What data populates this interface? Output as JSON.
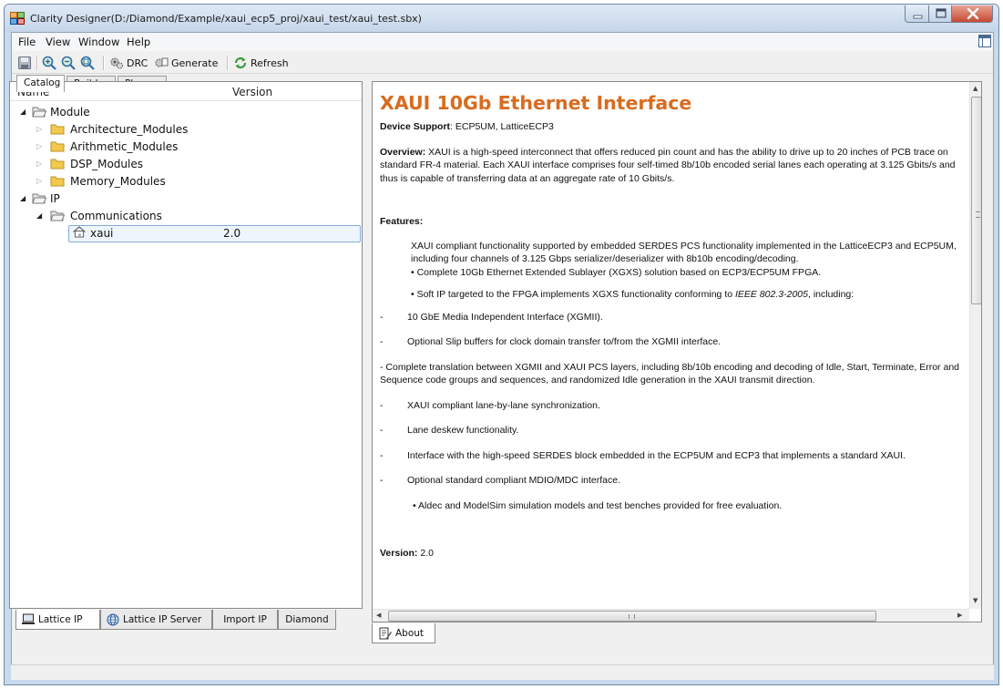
{
  "window": {
    "title": "Clarity Designer(D:/Diamond/Example/xaui_ecp5_proj/xaui_test/xaui_test.sbx)"
  },
  "menu": [
    "File",
    "View",
    "Window",
    "Help"
  ],
  "toolbar": {
    "drc_label": "DRC",
    "generate_label": "Generate",
    "refresh_label": "Refresh"
  },
  "main_tabs": [
    "Catalog",
    "Builder",
    "Planner"
  ],
  "catalog": {
    "columns": {
      "name": "Name",
      "version": "Version"
    },
    "tree": [
      {
        "label": "Module",
        "level": 0,
        "state": "expanded",
        "icon": "folder-open-icon"
      },
      {
        "label": "Architecture_Modules",
        "level": 1,
        "state": "collapsed",
        "icon": "folder-icon"
      },
      {
        "label": "Arithmetic_Modules",
        "level": 1,
        "state": "collapsed",
        "icon": "folder-icon"
      },
      {
        "label": "DSP_Modules",
        "level": 1,
        "state": "collapsed",
        "icon": "folder-icon"
      },
      {
        "label": "Memory_Modules",
        "level": 1,
        "state": "collapsed",
        "icon": "folder-icon"
      },
      {
        "label": "IP",
        "level": 0,
        "state": "expanded",
        "icon": "folder-open-icon"
      },
      {
        "label": "Communications",
        "level": 1,
        "state": "expanded",
        "icon": "folder-open-icon"
      },
      {
        "label": "xaui",
        "level": 2,
        "version": "2.0",
        "selected": true,
        "icon": "house-icon"
      }
    ]
  },
  "left_tabs": [
    "Lattice IP",
    "Lattice IP Server",
    "Import IP",
    "Diamond"
  ],
  "about": {
    "heading": "XAUI 10Gb Ethernet Interface",
    "device_support_label": "Device Support",
    "device_support_value": ": ECP5UM, LatticeECP3",
    "overview_label": "Overview:",
    "overview_text": " XAUI is a high-speed interconnect that offers reduced pin count and has the ability to drive up to 20 inches of PCB trace on standard FR-4 material. Each XAUI interface comprises four self-timed 8b/10b encoded serial lanes each operating at 3.125 Gbits/s and thus is capable of transferring data at an aggregate rate of 10 Gbits/s.",
    "features_label": "Features:",
    "feature_intro": "XAUI compliant functionality supported by embedded SERDES PCS functionality implemented in the LatticeECP3 and ECP5UM, including four channels of 3.125 Gbps serializer/deserializer with 8b10b encoding/decoding.",
    "bullet_1": "• Complete 10Gb Ethernet Extended Sublayer (XGXS) solution based on ECP3/ECP5UM FPGA.",
    "bullet_2_prefix": "• Soft IP targeted to the FPGA implements XGXS functionality conforming to ",
    "bullet_2_italic": "IEEE 802.3-2005",
    "bullet_2_suffix": ", including:",
    "dash_items": [
      "10 GbE Media Independent Interface (XGMII).",
      "Optional Slip buffers for clock domain transfer to/from the XGMII interface."
    ],
    "dash_long": "-      Complete translation between XGMII and XAUI PCS layers, including 8b/10b encoding and decoding of Idle, Start, Terminate, Error and Sequence code groups and sequences, and randomized Idle generation in the XAUI transmit direction.",
    "dash_items_2": [
      "XAUI compliant lane-by-lane synchronization.",
      "Lane deskew functionality.",
      "Interface with the high-speed SERDES block embedded in the ECP5UM and ECP3 that implements a standard XAUI.",
      "Optional standard compliant MDIO/MDC interface."
    ],
    "bullet_3": "• Aldec and ModelSim simulation models and test benches provided for free evaluation.",
    "version_label": "Version:",
    "version_value": " 2.0"
  },
  "right_tabs": [
    "About"
  ],
  "colors": {
    "heading": "#d96b1f",
    "selection_border": "#84acdd",
    "folder": "#f2c94c"
  }
}
